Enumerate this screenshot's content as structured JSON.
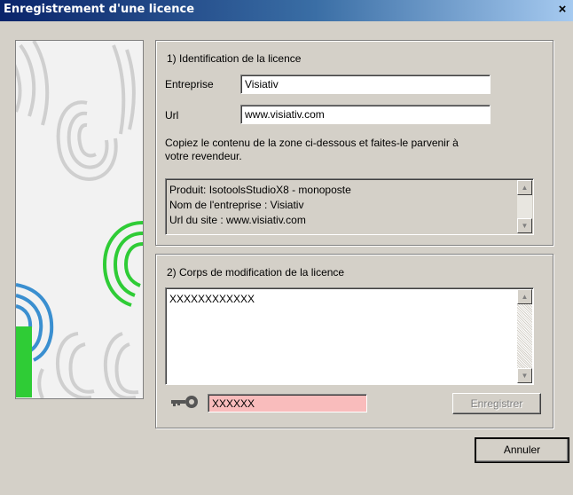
{
  "window": {
    "title": "Enregistrement d'une licence",
    "close_glyph": "×"
  },
  "section1": {
    "title": "1) Identification de la licence",
    "company_label": "Entreprise",
    "company_value": "Visiativ",
    "url_label": "Url",
    "url_value": "www.visiativ.com",
    "instructions_line1": "Copiez le contenu de la zone ci-dessous et faites-le parvenir à",
    "instructions_line2": "votre revendeur.",
    "info_lines": [
      "Produit: IsotoolsStudioX8 - monoposte",
      "Nom de l'entreprise : Visiativ",
      "Url du site : www.visiativ.com"
    ]
  },
  "section2": {
    "title": "2) Corps de modification de la licence",
    "body_value": "XXXXXXXXXXXX",
    "key_value": "XXXXXX",
    "register_label": "Enregistrer"
  },
  "cancel_label": "Annuler",
  "colors": {
    "titlebar_start": "#0a246a",
    "titlebar_end": "#a6caf0",
    "key_field_bg": "#f9bcbc",
    "fingerprint_green": "#2fcc36",
    "fingerprint_blue": "#3a8fd0"
  },
  "icons": [
    "close-icon",
    "key-icon",
    "scroll-up-icon",
    "scroll-down-icon"
  ]
}
